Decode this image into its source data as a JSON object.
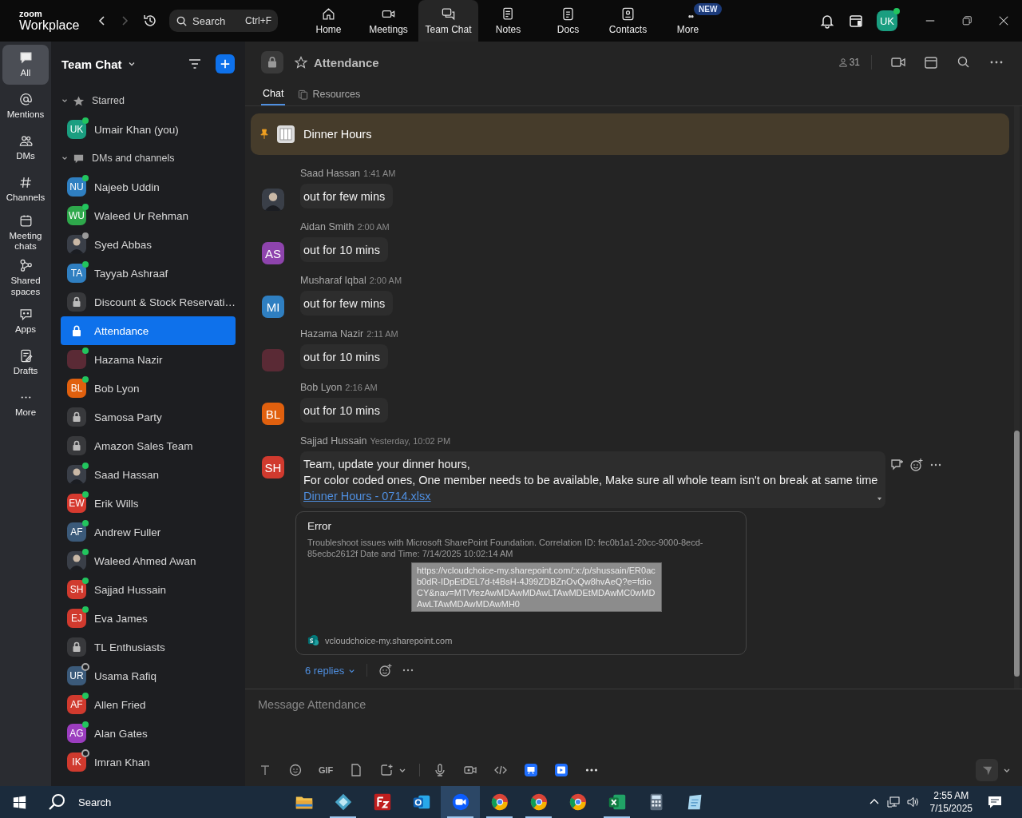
{
  "titlebar": {
    "logo_top": "zoom",
    "logo": "Workplace",
    "search": {
      "placeholder": "Search",
      "shortcut": "Ctrl+F"
    },
    "nav": [
      {
        "label": "Home",
        "selected": false
      },
      {
        "label": "Meetings",
        "selected": false
      },
      {
        "label": "Team Chat",
        "selected": true
      },
      {
        "label": "Notes",
        "selected": false
      },
      {
        "label": "Docs",
        "selected": false
      },
      {
        "label": "Contacts",
        "selected": false
      },
      {
        "label": "More",
        "selected": false,
        "badge": "NEW"
      }
    ],
    "avatar": {
      "initials": "UK",
      "color": "#1a9e80",
      "presence": {
        "kind": "dot",
        "color": "#22c55e"
      }
    }
  },
  "rail": [
    {
      "label": "All",
      "selected": true
    },
    {
      "label": "Mentions",
      "selected": false
    },
    {
      "label": "DMs",
      "selected": false
    },
    {
      "label": "Channels",
      "selected": false
    },
    {
      "label": "Meeting chats",
      "selected": false
    },
    {
      "label": "Shared spaces",
      "selected": false
    },
    {
      "label": "Apps",
      "selected": false
    },
    {
      "label": "Drafts",
      "selected": false
    },
    {
      "label": "More",
      "selected": false
    }
  ],
  "sidebar": {
    "title": "Team Chat",
    "sections": [
      {
        "label": "Starred",
        "expanded": true,
        "items": [
          {
            "name": "Umair Khan (you)",
            "selected": false,
            "avatar": {
              "kind": "initials",
              "initials": "UK",
              "color": "#1a9e80"
            },
            "presence": {
              "kind": "dot",
              "color": "#22c55e"
            }
          }
        ]
      },
      {
        "label": "DMs and channels",
        "expanded": true,
        "items": [
          {
            "name": "Najeeb Uddin",
            "selected": false,
            "avatar": {
              "kind": "initials",
              "initials": "NU",
              "color": "#2f7fc1"
            },
            "presence": {
              "kind": "dot",
              "color": "#22c55e"
            }
          },
          {
            "name": "Waleed Ur Rehman",
            "selected": false,
            "avatar": {
              "kind": "initials",
              "initials": "WU",
              "color": "#2ea84b"
            },
            "presence": {
              "kind": "dot",
              "color": "#22c55e"
            }
          },
          {
            "name": "Syed Abbas",
            "selected": false,
            "avatar": {
              "kind": "photo"
            },
            "presence": {
              "kind": "dot",
              "color": "#9a9a9a"
            }
          },
          {
            "name": "Tayyab Ashraaf",
            "selected": false,
            "avatar": {
              "kind": "initials",
              "initials": "TA",
              "color": "#2f7fc1"
            },
            "presence": {
              "kind": "dot",
              "color": "#22c55e"
            }
          },
          {
            "name": "Discount & Stock Reservati…",
            "selected": false,
            "avatar": {
              "kind": "lock"
            }
          },
          {
            "name": "Attendance",
            "selected": true,
            "avatar": {
              "kind": "lock"
            }
          },
          {
            "name": "Hazama Nazir",
            "selected": false,
            "avatar": {
              "kind": "blank",
              "color": "#5a2a35"
            },
            "presence": {
              "kind": "dot",
              "color": "#22c55e"
            }
          },
          {
            "name": "Bob Lyon",
            "selected": false,
            "avatar": {
              "kind": "initials",
              "initials": "BL",
              "color": "#e0600e"
            },
            "presence": {
              "kind": "dot",
              "color": "#22c55e"
            }
          },
          {
            "name": "Samosa Party",
            "selected": false,
            "avatar": {
              "kind": "lock"
            }
          },
          {
            "name": "Amazon Sales Team",
            "selected": false,
            "avatar": {
              "kind": "lock"
            }
          },
          {
            "name": "Saad Hassan",
            "selected": false,
            "avatar": {
              "kind": "photo"
            },
            "presence": {
              "kind": "dot",
              "color": "#22c55e"
            }
          },
          {
            "name": "Erik Wills",
            "selected": false,
            "avatar": {
              "kind": "initials",
              "initials": "EW",
              "color": "#d63a2f"
            },
            "presence": {
              "kind": "dot",
              "color": "#22c55e"
            }
          },
          {
            "name": "Andrew Fuller",
            "selected": false,
            "avatar": {
              "kind": "initials",
              "initials": "AF",
              "color": "#3b5a7a"
            },
            "presence": {
              "kind": "dot",
              "color": "#22c55e"
            }
          },
          {
            "name": "Waleed Ahmed Awan",
            "selected": false,
            "avatar": {
              "kind": "photo"
            },
            "presence": {
              "kind": "dot",
              "color": "#22c55e"
            }
          },
          {
            "name": "Sajjad Hussain",
            "selected": false,
            "avatar": {
              "kind": "initials",
              "initials": "SH",
              "color": "#d03a2e"
            },
            "presence": {
              "kind": "dot",
              "color": "#22c55e"
            }
          },
          {
            "name": "Eva James",
            "selected": false,
            "avatar": {
              "kind": "initials",
              "initials": "EJ",
              "color": "#d03a2e"
            },
            "presence": {
              "kind": "dot",
              "color": "#22c55e"
            }
          },
          {
            "name": "TL Enthusiasts",
            "selected": false,
            "avatar": {
              "kind": "lock"
            }
          },
          {
            "name": "Usama Rafiq",
            "selected": false,
            "avatar": {
              "kind": "initials",
              "initials": "UR",
              "color": "#3b5a7a"
            },
            "presence": {
              "kind": "ring",
              "color": "#aaaaaa"
            }
          },
          {
            "name": "Allen Fried",
            "selected": false,
            "avatar": {
              "kind": "initials",
              "initials": "AF",
              "color": "#d03a2e"
            },
            "presence": {
              "kind": "dot",
              "color": "#22c55e"
            }
          },
          {
            "name": "Alan Gates",
            "selected": false,
            "avatar": {
              "kind": "initials",
              "initials": "AG",
              "color": "#9b3dbf"
            },
            "presence": {
              "kind": "dot",
              "color": "#22c55e"
            }
          },
          {
            "name": "Imran Khan",
            "selected": false,
            "avatar": {
              "kind": "initials",
              "initials": "IK",
              "color": "#d03a2e"
            },
            "presence": {
              "kind": "ring",
              "color": "#aaaaaa"
            }
          }
        ]
      }
    ]
  },
  "channel": {
    "title": "Attendance",
    "members": "31",
    "tabs": [
      {
        "label": "Chat",
        "selected": true
      },
      {
        "label": "Resources",
        "selected": false
      }
    ],
    "pinned": "Dinner Hours"
  },
  "messages": [
    {
      "sender": "Saad Hassan",
      "time": "1:41 AM",
      "avatar": {
        "kind": "photo"
      },
      "lines": [
        "out for few mins"
      ]
    },
    {
      "sender": "Aidan Smith",
      "time": "2:00 AM",
      "avatar": {
        "kind": "initials",
        "initials": "AS",
        "color": "#8e44ad"
      },
      "lines": [
        "out for 10 mins"
      ]
    },
    {
      "sender": "Musharaf Iqbal",
      "time": "2:00 AM",
      "avatar": {
        "kind": "initials",
        "initials": "MI",
        "color": "#2f7fc1"
      },
      "lines": [
        "out for few mins"
      ]
    },
    {
      "sender": "Hazama Nazir",
      "time": "2:11 AM",
      "avatar": {
        "kind": "blank",
        "color": "#5a2a35"
      },
      "lines": [
        "out for 10 mins"
      ]
    },
    {
      "sender": "Bob Lyon",
      "time": "2:16 AM",
      "avatar": {
        "kind": "initials",
        "initials": "BL",
        "color": "#e0600e"
      },
      "lines": [
        "out for 10 mins"
      ]
    },
    {
      "sender": "Sajjad Hussain",
      "time": "Yesterday, 10:02 PM",
      "avatar": {
        "kind": "initials",
        "initials": "SH",
        "color": "#d03a2e"
      },
      "lines": [
        "Team, update your dinner hours,",
        "For color coded ones, One member needs to be available, Make sure all whole team isn't on break at same time"
      ],
      "link": "Dinner Hours - 0714.xlsx",
      "preview": {
        "title": "Error",
        "body": "Troubleshoot issues with Microsoft SharePoint Foundation. Correlation ID: fec0b1a1-20cc-9000-8ecd-85ecbc2612f Date and Time: 7/14/2025 10:02:14 AM",
        "tooltip": "https://vcloudchoice-my.sharepoint.com/:x:/p/shussain/ER0acb0dR-IDpEtDEL7d-t4BsH-4J99ZDBZnOvQw8hvAeQ?e=fdioCY&nav=MTVfezAwMDAwMDAwLTAwMDEtMDAwMC0wMDAwLTAwMDAwMDAwMH0",
        "domain": "vcloudchoice-my.sharepoint.com"
      },
      "replies": "6 replies"
    }
  ],
  "composer": {
    "placeholder": "Message Attendance",
    "gif": "GIF"
  },
  "taskbar": {
    "search": "Search",
    "apps": [
      {
        "selected": false,
        "running": false
      },
      {
        "selected": false,
        "running": true
      },
      {
        "selected": false,
        "running": false
      },
      {
        "selected": false,
        "running": false
      },
      {
        "selected": true,
        "running": true
      },
      {
        "selected": false,
        "running": true
      },
      {
        "selected": false,
        "running": true
      },
      {
        "selected": false,
        "running": false
      },
      {
        "selected": false,
        "running": true
      },
      {
        "selected": false,
        "running": false
      },
      {
        "selected": false,
        "running": false
      }
    ],
    "time": "2:55 AM",
    "date": "7/15/2025"
  }
}
